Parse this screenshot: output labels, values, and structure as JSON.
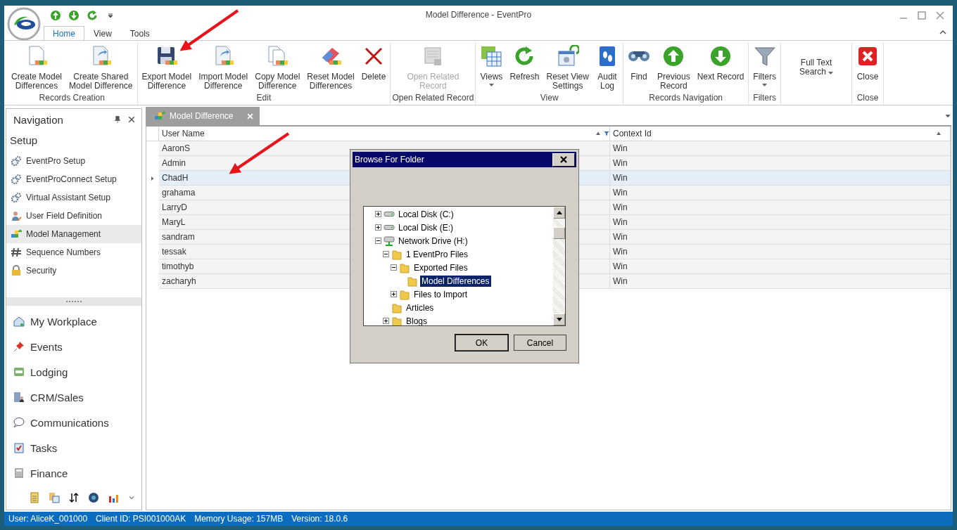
{
  "window": {
    "title": "Model Difference - EventPro"
  },
  "ribbon_tabs": [
    {
      "label": "Home",
      "selected": true
    },
    {
      "label": "View",
      "selected": false
    },
    {
      "label": "Tools",
      "selected": false
    }
  ],
  "ribbon_groups": [
    {
      "label": "Records Creation",
      "buttons": [
        {
          "kind": "doc",
          "lines": [
            "Create Model",
            "Differences"
          ],
          "disabled": false,
          "dropdown": false
        },
        {
          "kind": "docshare",
          "lines": [
            "Create Shared",
            "Model Difference"
          ],
          "disabled": false,
          "dropdown": false
        }
      ]
    },
    {
      "label": "Edit",
      "buttons": [
        {
          "kind": "floppy",
          "lines": [
            "Export Model",
            "Difference"
          ],
          "disabled": false,
          "dropdown": false
        },
        {
          "kind": "docshare",
          "lines": [
            "Import Model",
            "Difference"
          ],
          "disabled": false,
          "dropdown": false
        },
        {
          "kind": "copy",
          "lines": [
            "Copy Model",
            "Difference"
          ],
          "disabled": false,
          "dropdown": false
        },
        {
          "kind": "eraser",
          "lines": [
            "Reset Model",
            "Differences"
          ],
          "disabled": false,
          "dropdown": false
        },
        {
          "kind": "cross",
          "lines": [
            "Delete"
          ],
          "disabled": false,
          "dropdown": false
        }
      ]
    },
    {
      "label": "Open Related Record",
      "buttons": [
        {
          "kind": "server",
          "lines": [
            "Open Related",
            "Record"
          ],
          "disabled": true,
          "dropdown": false
        }
      ]
    },
    {
      "label": "View",
      "buttons": [
        {
          "kind": "grid",
          "lines": [
            "Views"
          ],
          "disabled": false,
          "dropdown": true
        },
        {
          "kind": "refresh",
          "lines": [
            "Refresh"
          ],
          "disabled": false,
          "dropdown": false
        },
        {
          "kind": "gearwin",
          "lines": [
            "Reset View",
            "Settings"
          ],
          "disabled": false,
          "dropdown": false
        },
        {
          "kind": "book",
          "lines": [
            "Audit",
            "Log"
          ],
          "disabled": false,
          "dropdown": false
        }
      ]
    },
    {
      "label": "Records Navigation",
      "buttons": [
        {
          "kind": "binoculars",
          "lines": [
            "Find"
          ],
          "disabled": false,
          "dropdown": false
        },
        {
          "kind": "up",
          "lines": [
            "Previous",
            "Record"
          ],
          "disabled": false,
          "dropdown": false
        },
        {
          "kind": "down",
          "lines": [
            "Next Record"
          ],
          "disabled": false,
          "dropdown": false
        }
      ]
    },
    {
      "label": "Filters",
      "buttons": [
        {
          "kind": "funnel",
          "lines": [
            "Filters"
          ],
          "disabled": false,
          "dropdown": true
        }
      ]
    },
    {
      "buttons": [
        {
          "kind": "text",
          "lines": [
            "Full Text",
            "Search"
          ],
          "disabled": false,
          "dropdown": true
        }
      ]
    },
    {
      "label": "Close",
      "buttons": [
        {
          "kind": "closered",
          "lines": [
            "Close"
          ],
          "disabled": false,
          "dropdown": false
        }
      ]
    }
  ],
  "navigation": {
    "title": "Navigation",
    "section": "Setup",
    "setup_items": [
      {
        "label": "EventPro Setup",
        "kind": "gears",
        "selected": false
      },
      {
        "label": "EventProConnect Setup",
        "kind": "gears",
        "selected": false
      },
      {
        "label": "Virtual Assistant Setup",
        "kind": "gears",
        "selected": false
      },
      {
        "label": "User Field Definition",
        "kind": "user",
        "selected": false
      },
      {
        "label": "Model Management",
        "kind": "blocks",
        "selected": true
      },
      {
        "label": "Sequence Numbers",
        "kind": "hash",
        "selected": false
      },
      {
        "label": "Security",
        "kind": "lock",
        "selected": false
      }
    ],
    "modules": [
      {
        "label": "My Workplace",
        "kind": "house"
      },
      {
        "label": "Events",
        "kind": "pin"
      },
      {
        "label": "Lodging",
        "kind": "bed"
      },
      {
        "label": "CRM/Sales",
        "kind": "office"
      },
      {
        "label": "Communications",
        "kind": "bubble"
      },
      {
        "label": "Tasks",
        "kind": "clipboard"
      },
      {
        "label": "Finance",
        "kind": "calculator"
      }
    ]
  },
  "document_tab": {
    "label": "Model Difference"
  },
  "table": {
    "columns": [
      "User Name",
      "Context Id"
    ],
    "rows": [
      {
        "user_name": "AaronS",
        "context_id": "Win",
        "selected": false
      },
      {
        "user_name": "Admin",
        "context_id": "Win",
        "selected": false
      },
      {
        "user_name": "ChadH",
        "context_id": "Win",
        "selected": true
      },
      {
        "user_name": "grahama",
        "context_id": "Win",
        "selected": false
      },
      {
        "user_name": "LarryD",
        "context_id": "Win",
        "selected": false
      },
      {
        "user_name": "MaryL",
        "context_id": "Win",
        "selected": false
      },
      {
        "user_name": "sandram",
        "context_id": "Win",
        "selected": false
      },
      {
        "user_name": "tessak",
        "context_id": "Win",
        "selected": false
      },
      {
        "user_name": "timothyb",
        "context_id": "Win",
        "selected": false
      },
      {
        "user_name": "zacharyh",
        "context_id": "Win",
        "selected": false
      }
    ]
  },
  "dialog": {
    "title": "Browse For Folder",
    "tree": [
      {
        "label": "Local Disk (C:)",
        "kind": "drive",
        "expandable": true,
        "expanded": false,
        "selected": false
      },
      {
        "label": "Local Disk (E:)",
        "kind": "drive",
        "expandable": true,
        "expanded": false,
        "selected": false
      },
      {
        "label": "Network Drive (H:)",
        "kind": "network",
        "expandable": true,
        "expanded": true,
        "selected": false,
        "children": [
          {
            "label": "1 EventPro Files",
            "kind": "folder",
            "expandable": true,
            "expanded": true,
            "selected": false,
            "children": [
              {
                "label": "Exported Files",
                "kind": "folder",
                "expandable": true,
                "expanded": true,
                "selected": false,
                "children": [
                  {
                    "label": "Model Differences",
                    "kind": "folder",
                    "expandable": false,
                    "selected": true
                  }
                ]
              },
              {
                "label": "Files to Import",
                "kind": "folder",
                "expandable": true,
                "expanded": false,
                "selected": false
              }
            ]
          },
          {
            "label": "Articles",
            "kind": "folder",
            "expandable": false,
            "selected": false
          },
          {
            "label": "Blogs",
            "kind": "folder",
            "expandable": true,
            "expanded": false,
            "selected": false
          }
        ]
      }
    ],
    "buttons": [
      "OK",
      "Cancel"
    ]
  },
  "status_bar": [
    "User: AliceK_001000",
    "Client ID: PSI001000AK",
    "Memory Usage: 157MB",
    "Version: 18.0.6"
  ]
}
